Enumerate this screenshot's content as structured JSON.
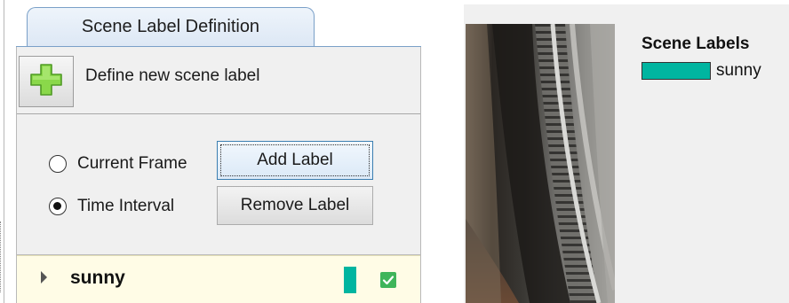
{
  "panel": {
    "tab_label": "Scene Label Definition",
    "define_new_label": "Define new scene label",
    "radio_current_frame": "Current Frame",
    "radio_time_interval": "Time Interval",
    "selected_option": "Time Interval",
    "add_label_button": "Add Label",
    "remove_label_button": "Remove Label",
    "labels": [
      {
        "name": "sunny",
        "color": "#00b5a0",
        "checked": true
      }
    ]
  },
  "viewer": {
    "legend_title": "Scene Labels",
    "legend_items": [
      {
        "name": "sunny",
        "color": "#00b5a0"
      }
    ]
  },
  "icons": {
    "add": "plus-icon",
    "expand": "caret-right-icon",
    "visible": "checkbox-checked-icon"
  },
  "colors": {
    "accent": "#3c7fb1",
    "label_row_bg": "#fffce6",
    "plus_green": "#7fd13b",
    "check_green": "#3fb55a"
  }
}
